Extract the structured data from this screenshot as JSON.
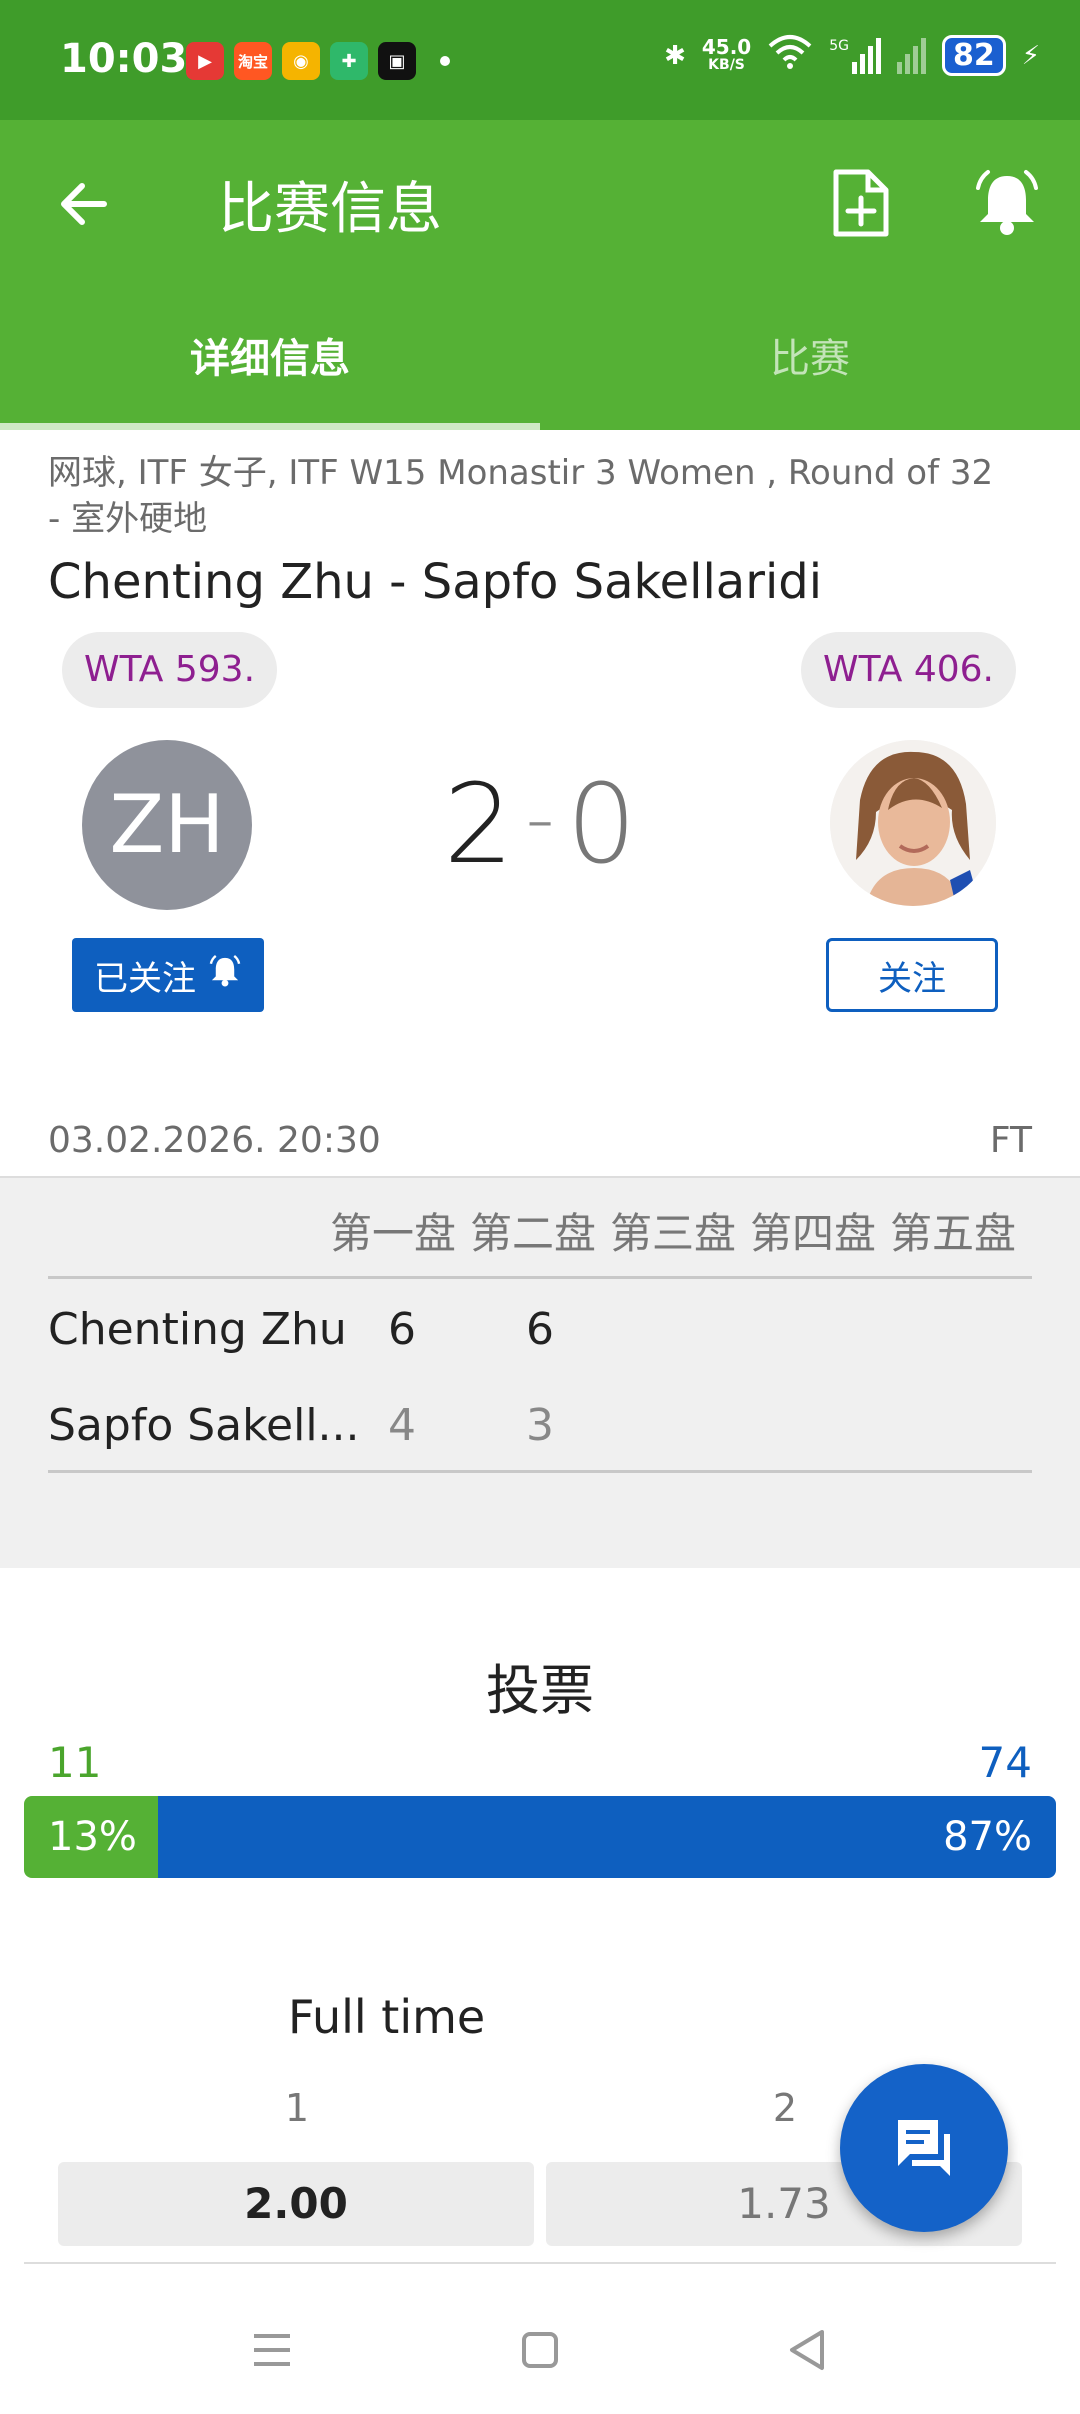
{
  "status_bar": {
    "time": "10:03",
    "apps": [
      {
        "icon": "youtube-icon",
        "color": "#e53935"
      },
      {
        "icon": "taobao-icon",
        "color": "#ff5722",
        "label": "淘宝"
      },
      {
        "icon": "weibo-icon",
        "color": "#f5b400"
      },
      {
        "icon": "shield-icon",
        "color": "#2fb86a"
      },
      {
        "icon": "video-icon",
        "color": "#111111"
      }
    ],
    "net_speed_value": "45.0",
    "net_speed_unit": "KB/S",
    "signal_label": "5G",
    "battery": "82"
  },
  "app_bar": {
    "title": "比赛信息",
    "back_icon": "arrow-left-icon",
    "add_icon": "add-document-icon",
    "bell_icon": "bell-icon"
  },
  "tabs": [
    {
      "label": "详细信息",
      "active": true
    },
    {
      "label": "比赛",
      "active": false
    }
  ],
  "match": {
    "meta": "网球, ITF 女子, ITF W15 Monastir 3 Women , Round of 32 - 室外硬地",
    "title": "Chenting Zhu - Sapfo Sakellaridi",
    "player1": {
      "rank": "WTA 593.",
      "initials": "ZH",
      "follow_label": "已关注",
      "following": true
    },
    "player2": {
      "rank": "WTA 406.",
      "follow_label": "关注",
      "following": false
    },
    "score_home": "2",
    "score_sep": "-",
    "score_away": "0",
    "datetime": "03.02.2026. 20:30",
    "status": "FT"
  },
  "sets": {
    "headers": [
      "第一盘",
      "第二盘",
      "第三盘",
      "第四盘",
      "第五盘"
    ],
    "rows": [
      {
        "name": "Chenting Zhu",
        "scores": [
          "6",
          "6"
        ]
      },
      {
        "name": "Sapfo Sakell...",
        "scores": [
          "4",
          "3"
        ]
      }
    ]
  },
  "vote": {
    "title": "投票",
    "left_count": "11",
    "right_count": "74",
    "left_pct": "13%",
    "right_pct": "87%",
    "left_share": 0.13,
    "left_color": "#55b135",
    "right_color": "#0e5fbf"
  },
  "odds": {
    "title": "Full time",
    "labels": [
      "1",
      "2"
    ],
    "values": [
      "2.00",
      "1.73"
    ]
  },
  "fab": {
    "icon": "chat-icon"
  },
  "nav": {
    "menu_icon": "menu-icon",
    "home_icon": "home-icon",
    "back_icon": "back-triangle-icon"
  },
  "colors": {
    "primary": "#55b135",
    "status_bar": "#3f9c2a",
    "accent_blue": "#0e5fbf",
    "rank_text": "#8e1f90"
  }
}
